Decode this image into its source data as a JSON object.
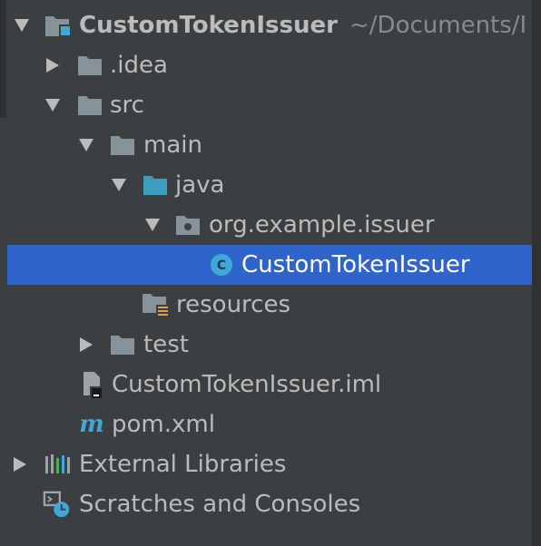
{
  "tree": {
    "root": {
      "label": "CustomTokenIssuer",
      "path": "~/Documents/I",
      "icon": "module-folder-icon"
    },
    "items": [
      {
        "label": ".idea",
        "icon": "folder-icon"
      },
      {
        "label": "src",
        "icon": "folder-icon"
      },
      {
        "label": "main",
        "icon": "folder-icon"
      },
      {
        "label": "java",
        "icon": "source-folder-icon"
      },
      {
        "label": "org.example.issuer",
        "icon": "package-icon"
      },
      {
        "label": "CustomTokenIssuer",
        "icon": "java-class-icon"
      },
      {
        "label": "resources",
        "icon": "resources-folder-icon"
      },
      {
        "label": "test",
        "icon": "folder-icon"
      },
      {
        "label": "CustomTokenIssuer.iml",
        "icon": "iml-file-icon"
      },
      {
        "label": "pom.xml",
        "icon": "maven-icon"
      },
      {
        "label": "External Libraries",
        "icon": "libraries-icon"
      },
      {
        "label": "Scratches and Consoles",
        "icon": "scratches-icon"
      }
    ]
  },
  "colors": {
    "background": "#3c3f41",
    "selection": "#2f65ca",
    "text": "#bbbbbb",
    "muted_text": "#8a8a8a",
    "folder": "#87939a",
    "source_folder": "#3d9ec0",
    "accent_blue": "#40a7d8"
  }
}
